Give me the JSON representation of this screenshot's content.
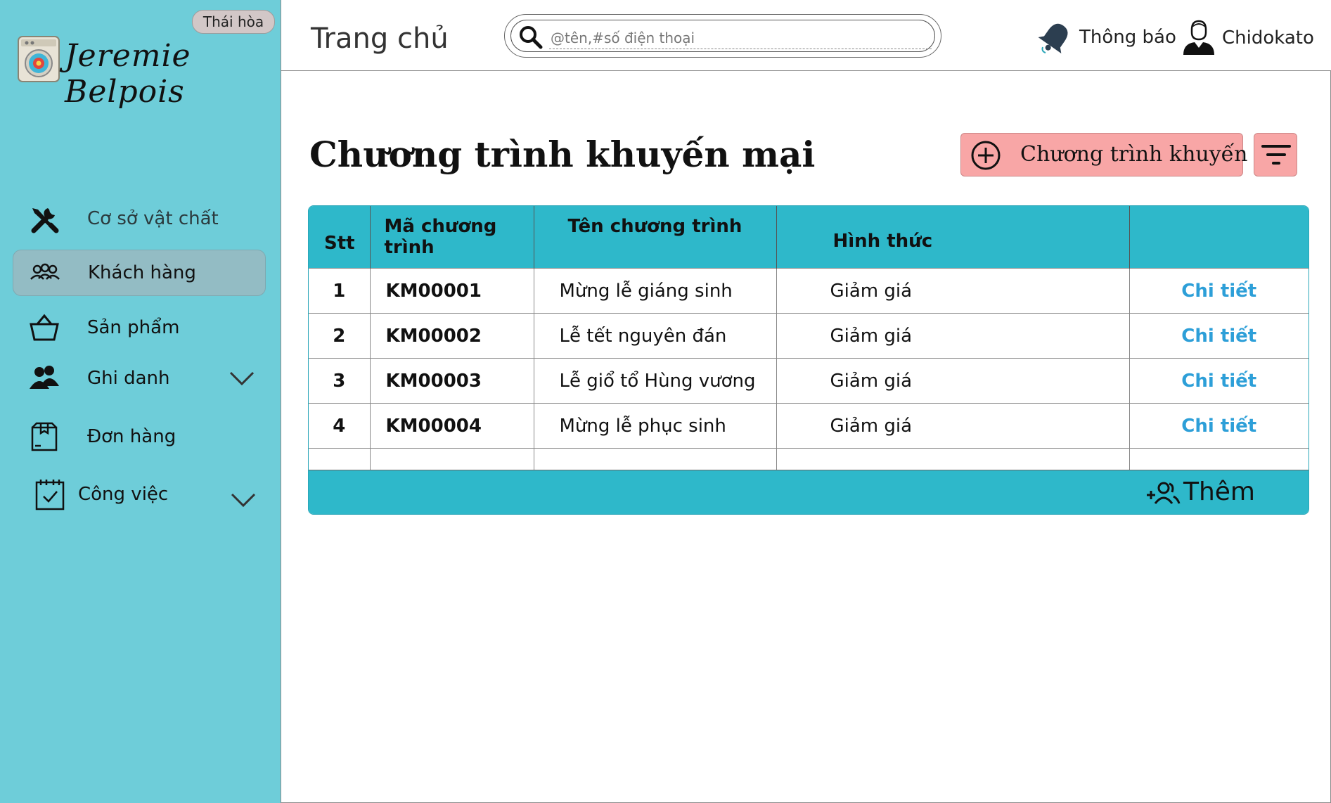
{
  "sidebar": {
    "branch": "Thái hòa",
    "brand": "Jeremie Belpois",
    "items": [
      {
        "label": "Cơ sở vật chất",
        "icon": "wrench-screwdriver-icon"
      },
      {
        "label": "Khách hàng",
        "icon": "customers-icon",
        "active": true
      },
      {
        "label": "Sản phẩm",
        "icon": "basket-icon"
      },
      {
        "label": "Ghi danh",
        "icon": "users-icon",
        "expandable": true
      },
      {
        "label": "Đơn hàng",
        "icon": "order-box-icon"
      },
      {
        "label": "Công việc",
        "icon": "calendar-check-icon",
        "expandable": true
      }
    ]
  },
  "header": {
    "title": "Trang chủ",
    "search_placeholder": "@tên,#số điện thoại",
    "notification_label": "Thông báo",
    "user_name": "Chidokato"
  },
  "main": {
    "title": "Chương trình khuyến mại",
    "add_button_label": "Chương trình khuyến mãi",
    "table": {
      "headers": [
        "Stt",
        "Mã chương trình",
        "Tên chương trình",
        "Hình thức",
        ""
      ],
      "rows": [
        {
          "stt": "1",
          "code": "KM00001",
          "name": "Mừng lễ giáng sinh",
          "type": "Giảm giá",
          "action": "Chi tiết"
        },
        {
          "stt": "2",
          "code": "KM00002",
          "name": "Lễ tết nguyên đán",
          "type": "Giảm giá",
          "action": "Chi tiết"
        },
        {
          "stt": "3",
          "code": "KM00003",
          "name": "Lễ giổ tổ Hùng vương",
          "type": "Giảm giá",
          "action": "Chi tiết"
        },
        {
          "stt": "4",
          "code": "KM00004",
          "name": "Mừng lễ phục sinh",
          "type": "Giảm giá",
          "action": "Chi tiết"
        }
      ],
      "footer_add_label": "Thêm"
    }
  },
  "colors": {
    "sidebar_bg": "#6ecdd9",
    "active_item_bg": "#93bcc4",
    "table_header_bg": "#2eb8ca",
    "primary_button_bg": "#f8a6a6",
    "link": "#2d9fd8"
  }
}
